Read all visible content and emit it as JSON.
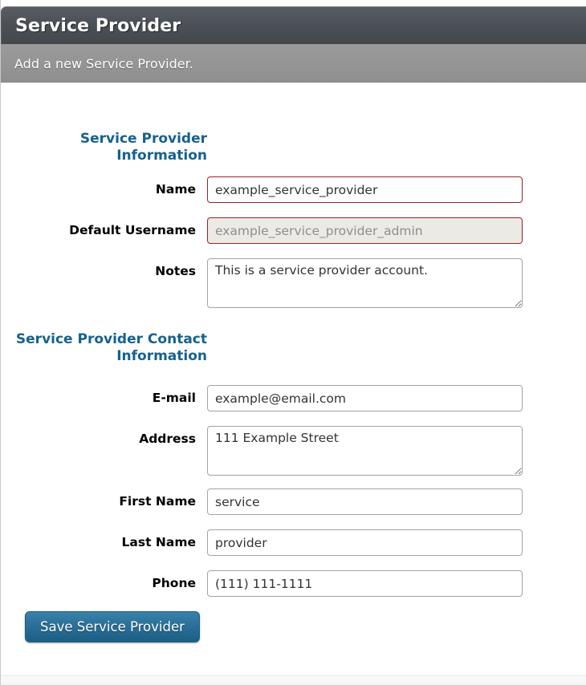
{
  "header": {
    "title": "Service Provider",
    "subtitle": "Add a new Service Provider."
  },
  "colors": {
    "accent_blue": "#15618f",
    "button_blue": "#2a7099",
    "error_border": "#9c2226",
    "disabled_bg": "#ebeae4",
    "titlebar_dark": "#4c5157",
    "subbar_grey": "#949494"
  },
  "sections": [
    {
      "legend": "Service Provider Information",
      "fields": [
        {
          "name": "name",
          "label": "Name",
          "value": "example_service_provider",
          "placeholder": "",
          "type": "text",
          "state": "error"
        },
        {
          "name": "default-username",
          "label": "Default Username",
          "value": "example_service_provider_admin",
          "placeholder": "",
          "type": "text",
          "state": "disabled"
        },
        {
          "name": "notes",
          "label": "Notes",
          "value": "This is a service provider account.",
          "placeholder": "",
          "type": "textarea",
          "state": "normal"
        }
      ]
    },
    {
      "legend": "Service Provider Contact Information",
      "fields": [
        {
          "name": "email",
          "label": "E-mail",
          "value": "example@email.com",
          "placeholder": "",
          "type": "text",
          "state": "normal"
        },
        {
          "name": "address",
          "label": "Address",
          "value": "111 Example Street",
          "placeholder": "",
          "type": "textarea",
          "state": "normal"
        },
        {
          "name": "first-name",
          "label": "First Name",
          "value": "service",
          "placeholder": "",
          "type": "text",
          "state": "normal"
        },
        {
          "name": "last-name",
          "label": "Last Name",
          "value": "provider",
          "placeholder": "",
          "type": "text",
          "state": "normal"
        },
        {
          "name": "phone",
          "label": "Phone",
          "value": "(111) 111-1111",
          "placeholder": "",
          "type": "text",
          "state": "normal"
        }
      ]
    }
  ],
  "actions": {
    "save_label": "Save Service Provider"
  }
}
